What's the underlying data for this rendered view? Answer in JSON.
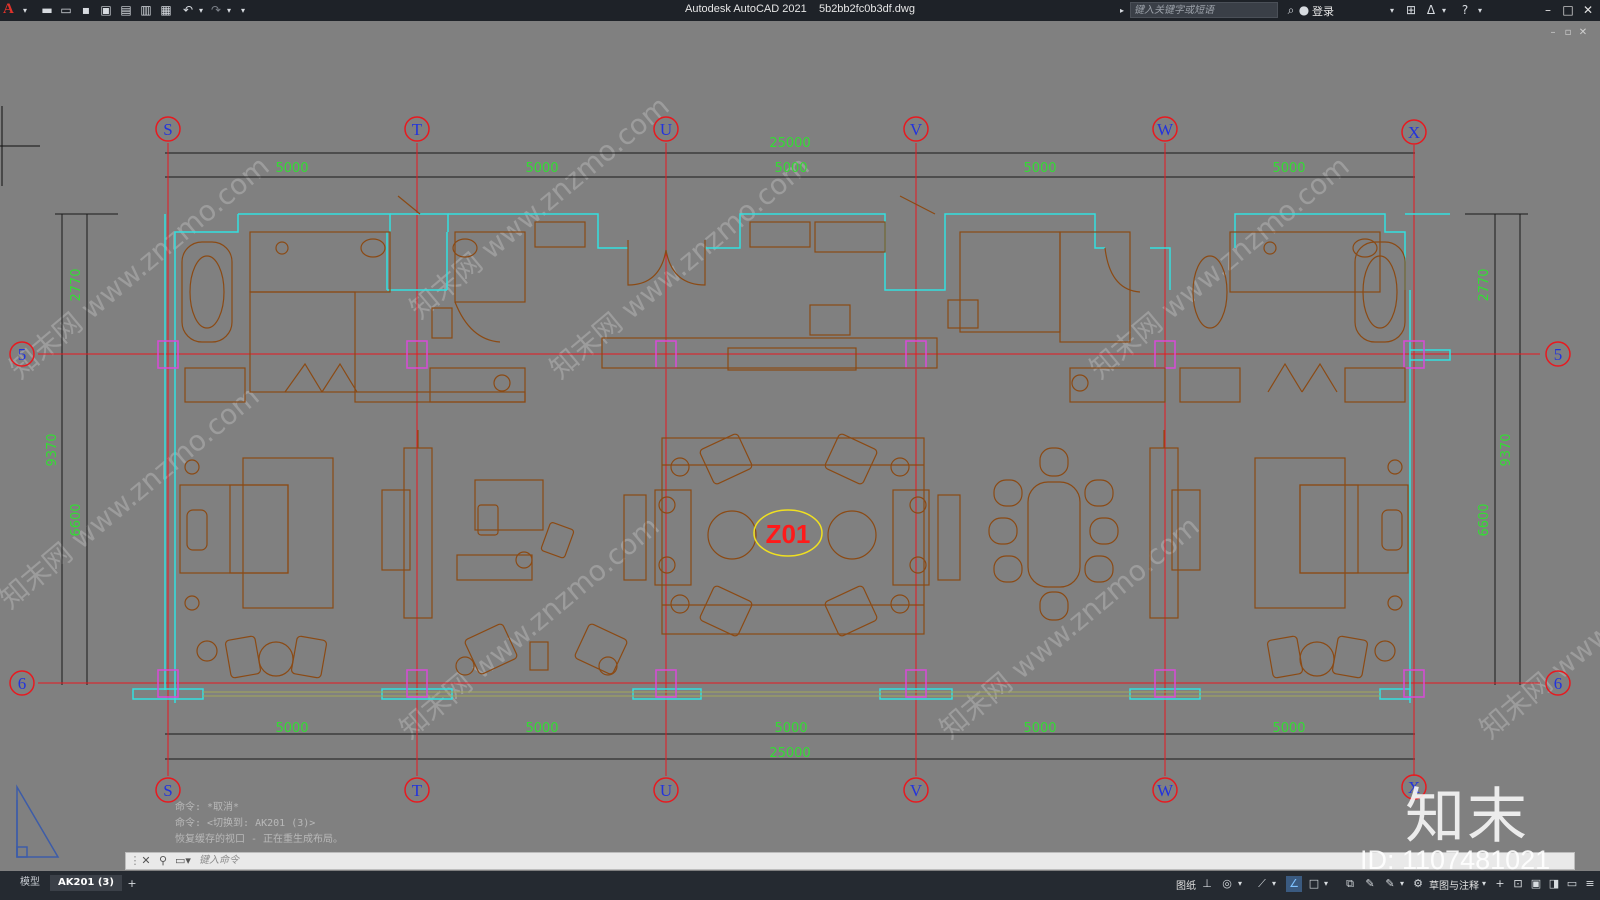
{
  "titlebar": {
    "app_name": "Autodesk AutoCAD 2021",
    "file_name": "5b2bb2fc0b3df.dwg",
    "search_placeholder": "键入关键字或短语",
    "login_label": "登录"
  },
  "grid": {
    "columns": [
      "S",
      "T",
      "U",
      "V",
      "W",
      "X"
    ],
    "rows": [
      "5",
      "6"
    ]
  },
  "dimensions": {
    "top_total": "25000",
    "top_spans": [
      "5000",
      "5000",
      "5000",
      "5000",
      "5000"
    ],
    "bottom_spans": [
      "5000",
      "5000",
      "5000",
      "5000",
      "5000"
    ],
    "bottom_total": "25000",
    "left_outer": "9370",
    "left_upper": "2770",
    "left_lower": "6600",
    "right_outer": "9370",
    "right_upper": "2770",
    "right_lower": "6600"
  },
  "room_tag": "Z01",
  "command_history": [
    "命令: *取消*",
    "命令:   <切换到: AK201 (3)>",
    "恢复缓存的视口 - 正在重生成布局。"
  ],
  "command_input_placeholder": "键入命令",
  "statusbar": {
    "tabs": [
      "模型",
      "AK201 (3)"
    ],
    "paper_label": "图纸",
    "workspace_label": "草图与注释"
  },
  "watermark": {
    "text": "知末网 www.znzmo.com",
    "logo": "知末",
    "id": "ID: 1107481021"
  },
  "colors": {
    "grid_line": "#e8191f",
    "dimension_text": "#33dd33",
    "furniture": "#8b4a14",
    "wall": "#33e0e0",
    "column_box": "#d84ad8",
    "room_tag": "#ff1a1a",
    "tag_ellipse": "#f0e020",
    "axis_letter": "#2233dd"
  }
}
